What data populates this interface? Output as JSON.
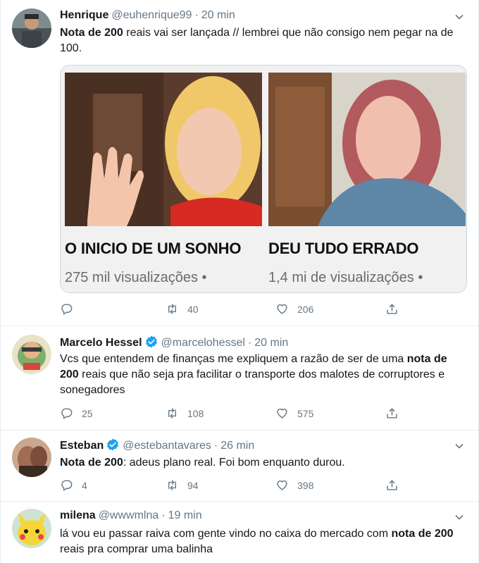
{
  "tweets": [
    {
      "name": "Henrique",
      "handle": "@euhenrique99",
      "time": "20 min",
      "text_parts": [
        {
          "bold": true,
          "text": "Nota de 200"
        },
        {
          "bold": false,
          "text": " reais vai ser lançada //  lembrei que não consigo nem pegar na de 100."
        }
      ],
      "card": {
        "left": {
          "caption": "O INICIO DE UM SONHO",
          "views": "275 mil visualizações •"
        },
        "right": {
          "caption": "DEU TUDO ERRADO",
          "views": "1,4 mi de visualizações •"
        }
      },
      "reply_count": "",
      "retweet_count": "40",
      "like_count": "206"
    },
    {
      "name": "Marcelo Hessel",
      "handle": "@marcelohessel",
      "time": "20 min",
      "text_parts": [
        {
          "bold": false,
          "text": "Vcs que entendem de finanças me expliquem a razão de ser de uma "
        },
        {
          "bold": true,
          "text": "nota de 200"
        },
        {
          "bold": false,
          "text": " reais que não seja pra facilitar o transporte dos malotes de corruptores e sonegadores"
        }
      ],
      "reply_count": "25",
      "retweet_count": "108",
      "like_count": "575"
    },
    {
      "name": "Esteban",
      "handle": "@estebantavares",
      "time": "26 min",
      "text_parts": [
        {
          "bold": true,
          "text": "Nota de 200"
        },
        {
          "bold": false,
          "text": ": adeus plano real. Foi bom enquanto durou."
        }
      ],
      "reply_count": "4",
      "retweet_count": "94",
      "like_count": "398"
    },
    {
      "name": "milena",
      "handle": "@wwwmlna",
      "time": "19 min",
      "text_parts": [
        {
          "bold": false,
          "text": "lá vou eu passar raiva com gente vindo no caixa do mercado com "
        },
        {
          "bold": true,
          "text": "nota de 200"
        },
        {
          "bold": false,
          "text": " reais pra comprar uma balinha"
        }
      ]
    }
  ],
  "colors": {
    "accent": "#1da1f2",
    "muted": "#657786",
    "text": "#14171a",
    "border": "#e6ecf0"
  },
  "icons": [
    "chevron-down-icon",
    "reply-icon",
    "retweet-icon",
    "like-icon",
    "share-icon",
    "verified-icon"
  ]
}
